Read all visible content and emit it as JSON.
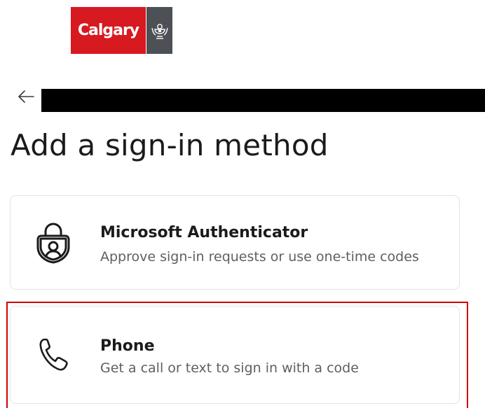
{
  "logo": {
    "text": "Calgary",
    "brand_red": "#d71920",
    "seal_gray": "#4d5156"
  },
  "header": {
    "back_icon": "arrow-left-icon",
    "account_redacted": true
  },
  "page": {
    "title": "Add a sign-in method"
  },
  "methods": [
    {
      "icon": "authenticator-lock-icon",
      "title": "Microsoft Authenticator",
      "description": "Approve sign-in requests or use one-time codes"
    },
    {
      "icon": "phone-icon",
      "title": "Phone",
      "description": "Get a call or text to sign in with a code",
      "highlighted": true
    }
  ],
  "colors": {
    "highlight": "#d00000",
    "card_border": "#e3e3e3",
    "text_primary": "#1b1b1b",
    "text_secondary": "#5f5f5f"
  }
}
